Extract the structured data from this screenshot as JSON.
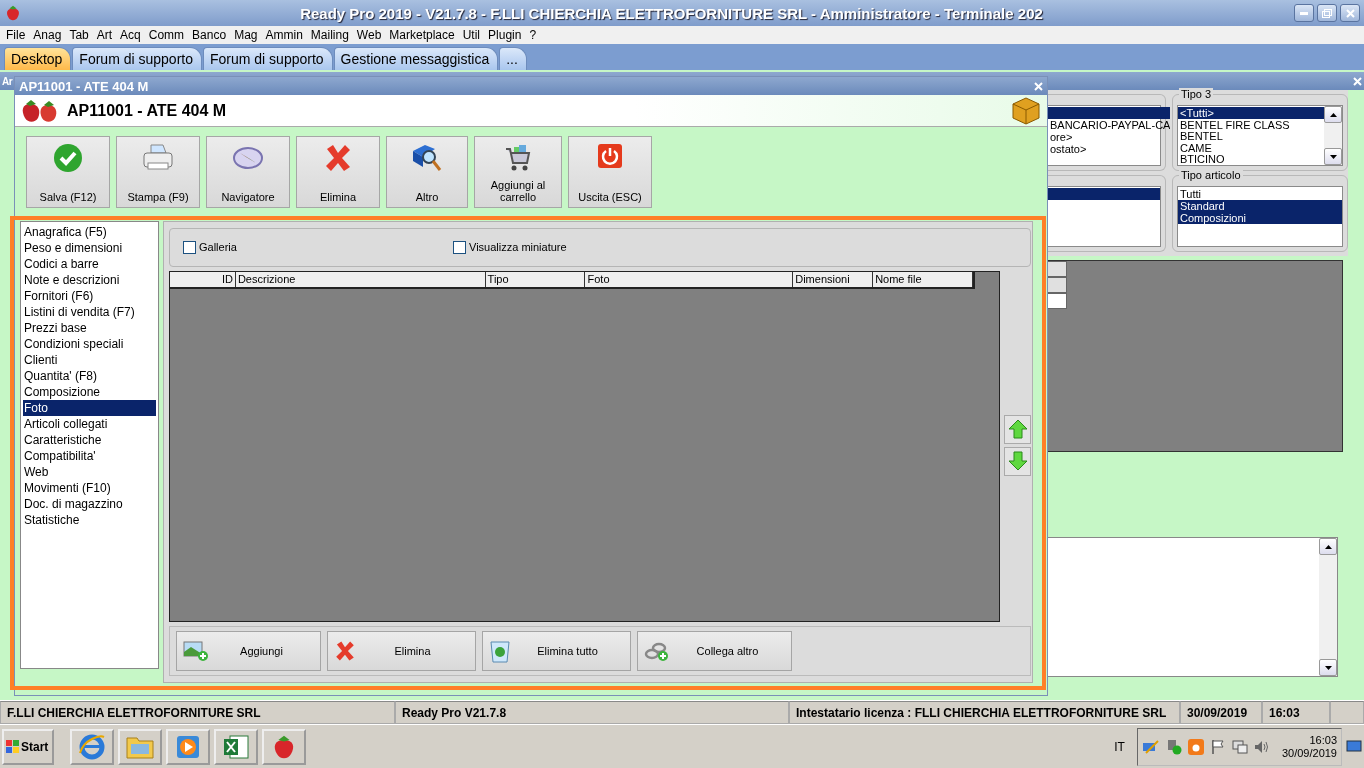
{
  "app": {
    "title": "Ready Pro 2019 - V21.7.8 - F.LLI CHIERCHIA ELETTROFORNITURE SRL - Amministratore - Terminale 202"
  },
  "menu": [
    "File",
    "Anag",
    "Tab",
    "Art",
    "Acq",
    "Comm",
    "Banco",
    "Mag",
    "Ammin",
    "Mailing",
    "Web",
    "Marketplace",
    "Util",
    "Plugin",
    "?"
  ],
  "tabs": [
    {
      "label": "Desktop",
      "selected": true
    },
    {
      "label": "Forum di supporto",
      "selected": false
    },
    {
      "label": "Forum di supporto",
      "selected": false
    },
    {
      "label": "Gestione messaggistica",
      "selected": false
    },
    {
      "label": "...",
      "selected": false
    }
  ],
  "background_window": {
    "title": "Ar",
    "list_1": [
      "BANCARIO-PAYPAL-CA",
      "ore>",
      "ostato>"
    ],
    "tipo_3": {
      "label": "Tipo 3",
      "items": [
        {
          "label": "<Tutti>",
          "selected": true
        },
        {
          "label": "BENTEL FIRE CLASS",
          "selected": false
        },
        {
          "label": "BENTEL",
          "selected": false
        },
        {
          "label": "CAME",
          "selected": false
        },
        {
          "label": "BTICINO",
          "selected": false
        }
      ]
    },
    "tipo_articolo": {
      "label": "Tipo articolo",
      "items": [
        {
          "label": "Tutti",
          "selected": false
        },
        {
          "label": "Standard",
          "selected": true
        },
        {
          "label": "Composizioni",
          "selected": true
        }
      ]
    }
  },
  "front_window": {
    "title": "AP11001 - ATE 404 M",
    "heading": "AP11001 - ATE 404 M",
    "toolbar": [
      "Salva (F12)",
      "Stampa (F9)",
      "Navigatore",
      "Elimina",
      "Altro",
      "Aggiungi al carrello",
      "Uscita (ESC)"
    ],
    "nav": [
      {
        "label": "Anagrafica (F5)",
        "selected": false
      },
      {
        "label": "Peso e dimensioni",
        "selected": false
      },
      {
        "label": "Codici a barre",
        "selected": false
      },
      {
        "label": "Note e descrizioni",
        "selected": false
      },
      {
        "label": "Fornitori (F6)",
        "selected": false
      },
      {
        "label": "Listini di vendita (F7)",
        "selected": false
      },
      {
        "label": "Prezzi base",
        "selected": false
      },
      {
        "label": "Condizioni speciali",
        "selected": false
      },
      {
        "label": "Clienti",
        "selected": false
      },
      {
        "label": "Quantita' (F8)",
        "selected": false
      },
      {
        "label": "Composizione",
        "selected": false
      },
      {
        "label": "Foto",
        "selected": true
      },
      {
        "label": "Articoli collegati",
        "selected": false
      },
      {
        "label": "Caratteristiche",
        "selected": false
      },
      {
        "label": "Compatibilita'",
        "selected": false
      },
      {
        "label": "Web",
        "selected": false
      },
      {
        "label": "Movimenti (F10)",
        "selected": false
      },
      {
        "label": "Doc. di magazzino",
        "selected": false
      },
      {
        "label": "Statistiche",
        "selected": false
      }
    ],
    "options": [
      {
        "label": "Galleria",
        "checked": false
      },
      {
        "label": "Visualizza miniature",
        "checked": false
      }
    ],
    "columns": [
      "ID",
      "Descrizione",
      "Tipo",
      "Foto",
      "Dimensioni",
      "Nome file"
    ],
    "actions": [
      "Aggiungi",
      "Elimina",
      "Elimina tutto",
      "Collega altro"
    ]
  },
  "status_bar": [
    "F.LLI CHIERCHIA ELETTROFORNITURE SRL",
    "Ready Pro V21.7.8",
    "Intestatario licenza : FLLI CHIERCHIA ELETTROFORNITURE SRL",
    "30/09/2019",
    "16:03"
  ],
  "taskbar": {
    "start": "Start",
    "language": "IT",
    "clock_time": "16:03",
    "clock_date": "30/09/2019"
  }
}
